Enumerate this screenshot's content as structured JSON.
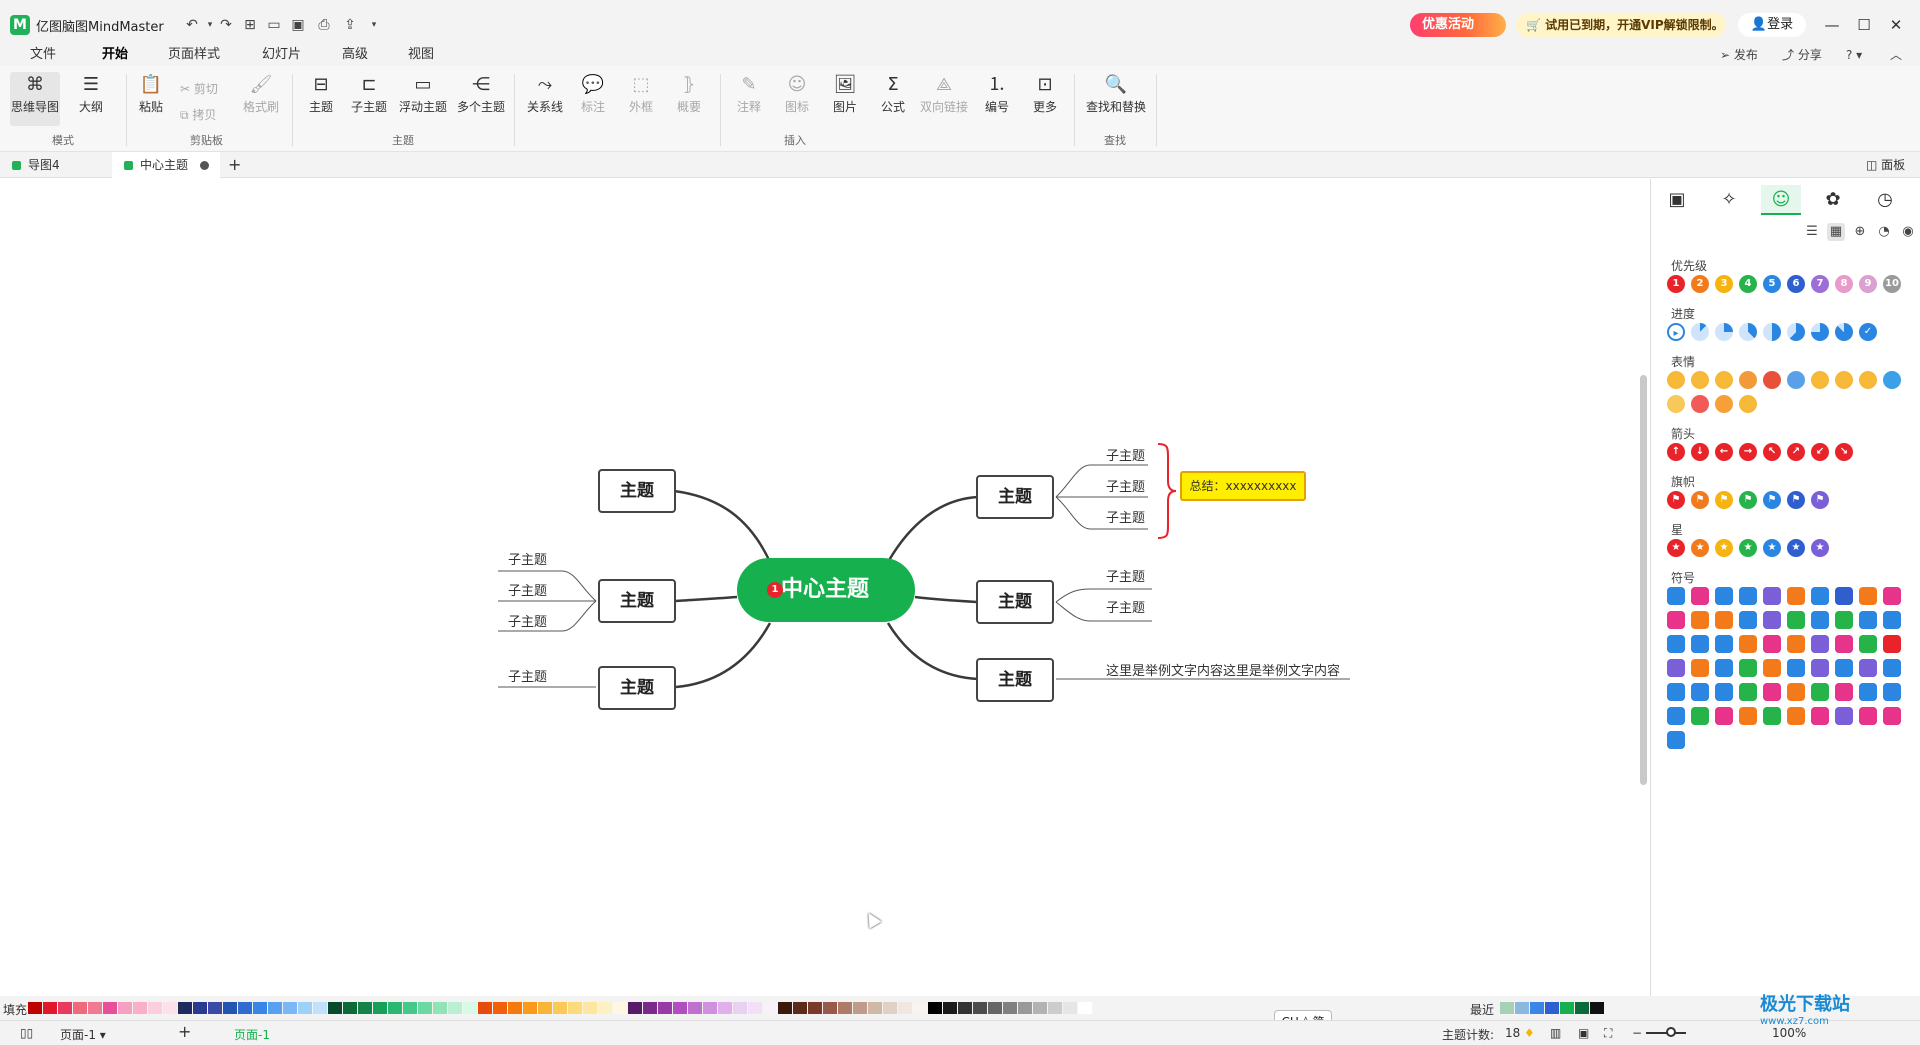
{
  "titlebar": {
    "logo": "M",
    "app_name": "亿图脑图MindMaster",
    "promo": "优惠活动",
    "vip_notice": "试用已到期，开通VIP解锁限制。",
    "login": "登录"
  },
  "menu": {
    "items": [
      "文件",
      "开始",
      "页面样式",
      "幻灯片",
      "高级",
      "视图"
    ],
    "active": "开始",
    "publish": "发布",
    "share": "分享"
  },
  "ribbon": {
    "mode": {
      "mindmap": "思维导图",
      "outline": "大纲",
      "group": "模式"
    },
    "clipboard": {
      "paste": "粘贴",
      "cut": "剪切",
      "copy": "拷贝",
      "format_painter": "格式刷",
      "group": "剪贴板"
    },
    "topic": {
      "topic": "主题",
      "subtopic": "子主题",
      "floating": "浮动主题",
      "multiple": "多个主题",
      "group": "主题"
    },
    "insert": {
      "relation": "关系线",
      "callout": "标注",
      "boundary": "外框",
      "summary": "概要",
      "note": "注释",
      "mark": "图标",
      "image": "图片",
      "formula": "公式",
      "bilink": "双向链接",
      "numbering": "编号",
      "more": "更多",
      "group": "插入"
    },
    "find": {
      "find_replace": "查找和替换",
      "group": "查找"
    }
  },
  "tabs": {
    "items": [
      {
        "label": "导图4"
      },
      {
        "label": "中心主题"
      }
    ],
    "panel_toggle": "面板"
  },
  "mindmap": {
    "central": {
      "label": "中心主题",
      "priority": "1"
    },
    "left_topics": [
      {
        "label": "主题",
        "subs": []
      },
      {
        "label": "主题",
        "subs": [
          "子主题",
          "子主题",
          "子主题"
        ]
      },
      {
        "label": "主题",
        "subs": [
          "子主题"
        ]
      }
    ],
    "right_topics": [
      {
        "label": "主题",
        "subs": [
          "子主题",
          "子主题",
          "子主题"
        ]
      },
      {
        "label": "主题",
        "subs": [
          "子主题",
          "子主题"
        ]
      },
      {
        "label": "主题",
        "subs": [
          "这里是举例文字内容这里是举例文字内容"
        ]
      }
    ],
    "summary": "总结：xxxxxxxxxx"
  },
  "panel": {
    "categories": {
      "priority": "优先级",
      "progress": "进度",
      "emoji": "表情",
      "arrow": "箭头",
      "flag": "旗帜",
      "star": "星",
      "symbol": "符号"
    },
    "priority_numbers": [
      "1",
      "2",
      "3",
      "4",
      "5",
      "6",
      "7",
      "8",
      "9",
      "10"
    ],
    "priority_colors": [
      "#e8232a",
      "#f27a1a",
      "#f5b40f",
      "#26b34a",
      "#2a86e0",
      "#2f5fcf",
      "#9b6ed8",
      "#e89acb",
      "#d9a0d0",
      "#9a9a9a"
    ],
    "accent": "#16b04f"
  },
  "bottom": {
    "fill_label": "填充",
    "recent_label": "最近",
    "ime": "CH ◊ 简",
    "page_selector": "页面-1",
    "page_tab": "页面-1",
    "topic_count_label": "主题计数:",
    "topic_count": "18",
    "zoom": "100%"
  },
  "watermark": {
    "text": "极光下载站",
    "sub": "www.xz7.com"
  }
}
